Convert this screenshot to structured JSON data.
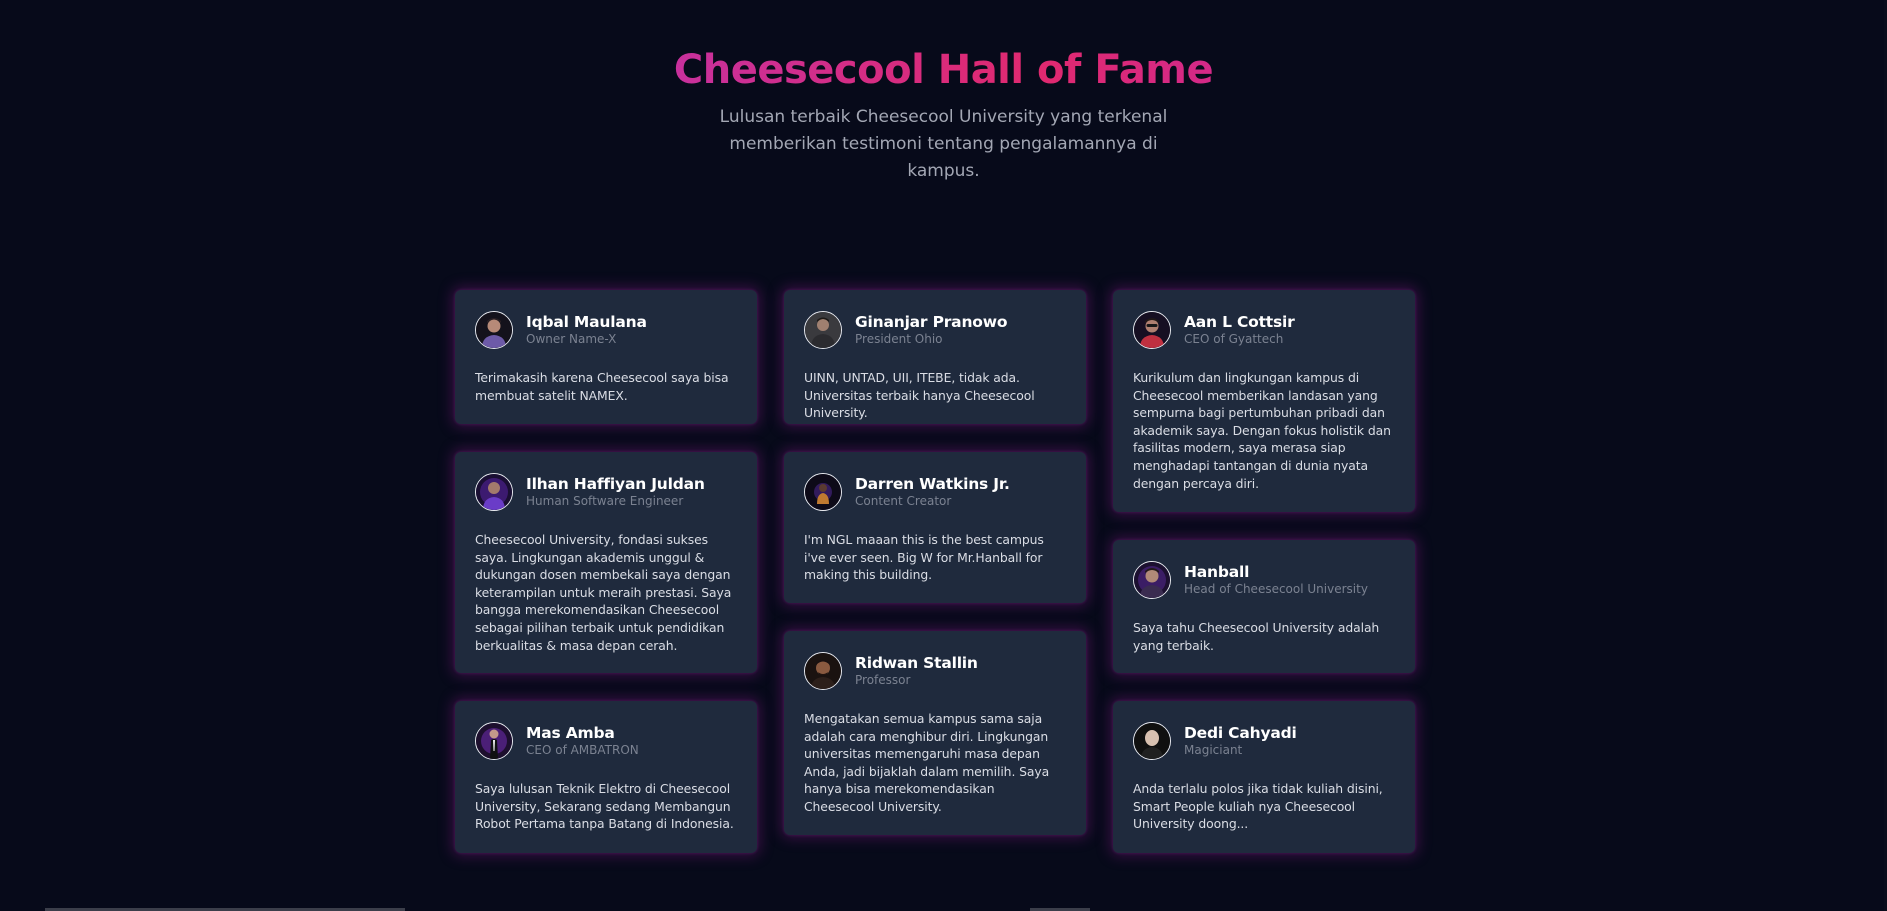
{
  "hero": {
    "title": "Cheesecool Hall of Fame",
    "subtitle": "Lulusan terbaik Cheesecool University yang terkenal memberikan testimoni tentang pengalamannya di kampus."
  },
  "colors": {
    "background": "#070a1a",
    "card": "#1f2a3d",
    "title_gradient": [
      "#9b3ef0",
      "#e0296f",
      "#a32ae8"
    ],
    "glow": "#a02ca0"
  },
  "testimonials": [
    {
      "name": "Iqbal Maulana",
      "role": "Owner Name-X",
      "quote": "Terimakasih karena Cheesecool saya bisa membuat satelit NAMEX.",
      "avatar_icon": "person-avatar-icon"
    },
    {
      "name": "Ginanjar Pranowo",
      "role": "President Ohio",
      "quote": "UINN, UNTAD, UII, ITEBE, tidak ada. Universitas terbaik hanya Cheesecool University.",
      "avatar_icon": "person-avatar-icon"
    },
    {
      "name": "Aan L Cottsir",
      "role": "CEO of Gyattech",
      "quote": "Kurikulum dan lingkungan kampus di Cheesecool memberikan landasan yang sempurna bagi pertumbuhan pribadi dan akademik saya. Dengan fokus holistik dan fasilitas modern, saya merasa siap menghadapi tantangan di dunia nyata dengan percaya diri.",
      "avatar_icon": "person-avatar-icon"
    },
    {
      "name": "Ilhan Haffiyan Juldan",
      "role": "Human Software Engineer",
      "quote": "Cheesecool University, fondasi sukses saya. Lingkungan akademis unggul & dukungan dosen membekali saya dengan keterampilan untuk meraih prestasi. Saya bangga merekomendasikan Cheesecool sebagai pilihan terbaik untuk pendidikan berkualitas & masa depan cerah.",
      "avatar_icon": "person-avatar-icon"
    },
    {
      "name": "Darren Watkins Jr.",
      "role": "Content Creator",
      "quote": "I'm NGL maaan this is the best campus i've ever seen. Big W for Mr.Hanball for making this building.",
      "avatar_icon": "person-avatar-icon"
    },
    {
      "name": "Hanball",
      "role": "Head of Cheesecool University",
      "quote": "Saya tahu Cheesecool University adalah yang terbaik.",
      "avatar_icon": "person-avatar-icon"
    },
    {
      "name": "Ridwan Stallin",
      "role": "Professor",
      "quote": "Mengatakan semua kampus sama saja adalah cara menghibur diri. Lingkungan universitas memengaruhi masa depan Anda, jadi bijaklah dalam memilih. Saya hanya bisa merekomendasikan Cheesecool University.",
      "avatar_icon": "person-avatar-icon"
    },
    {
      "name": "Mas Amba",
      "role": "CEO of AMBATRON",
      "quote": "Saya lulusan Teknik Elektro di Cheesecool University, Sekarang sedang Membangun Robot Pertama tanpa Batang di Indonesia.",
      "avatar_icon": "person-avatar-icon"
    },
    {
      "name": "Dedi Cahyadi",
      "role": "Magiciant",
      "quote": "Anda terlalu polos jika tidak kuliah disini, Smart People kuliah nya Cheesecool University doong...",
      "avatar_icon": "person-avatar-icon"
    }
  ]
}
